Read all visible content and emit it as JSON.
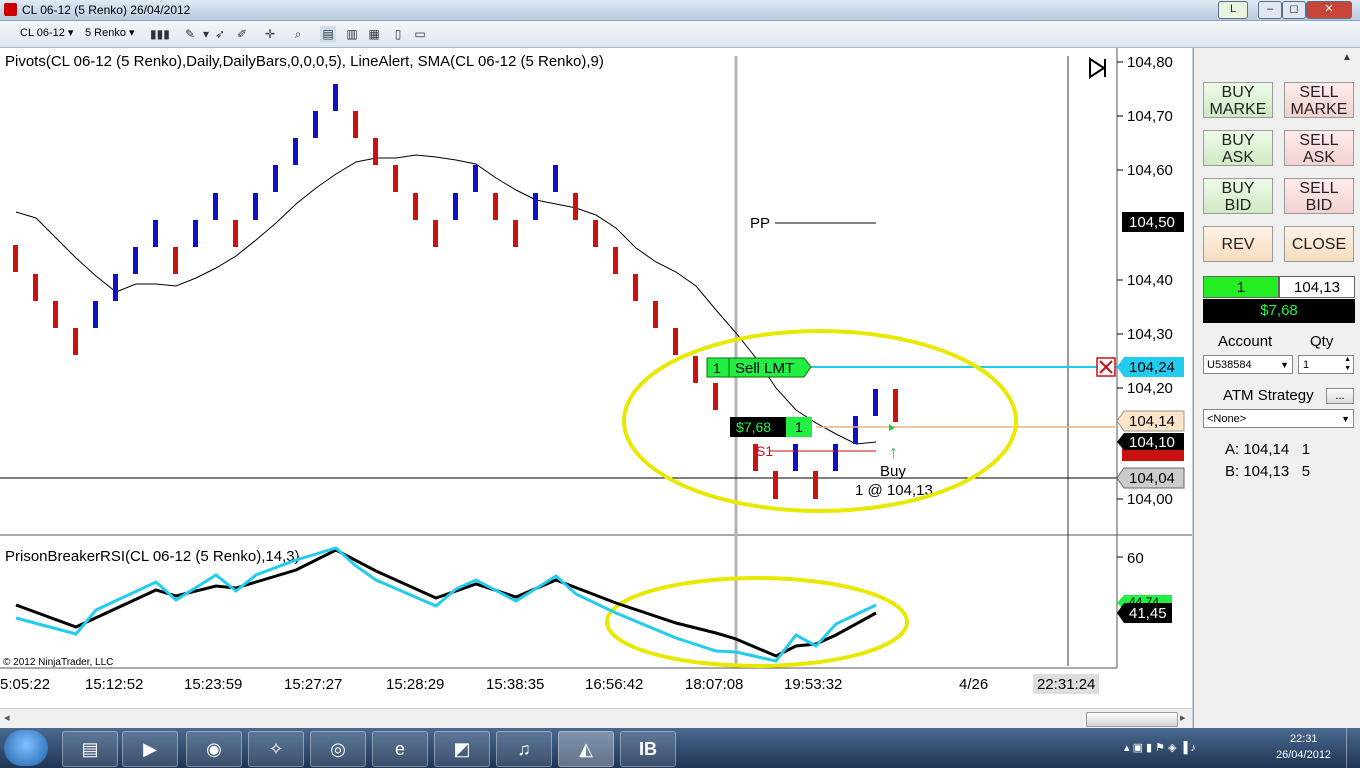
{
  "window": {
    "title": "CL 06-12 (5 Renko)  26/04/2012",
    "l_button": "L"
  },
  "toolbar": {
    "instrument": "CL 06-12",
    "bar_type": "5 Renko"
  },
  "chart": {
    "indicator_label": "Pivots(CL 06-12 (5 Renko),Daily,DailyBars,0,0,0,5), LineAlert, SMA(CL 06-12 (5 Renko),9)",
    "price_ticks": [
      "104,80",
      "104,70",
      "104,60",
      "104,50",
      "104,40",
      "104,30",
      "104,24",
      "104,20",
      "104,14",
      "104,10",
      "104,04",
      "104,00"
    ],
    "pivot_label": "PP",
    "sell_order": {
      "qty": "1",
      "label": "Sell LMT",
      "price": "104,24"
    },
    "position": {
      "pnl": "$7,68",
      "qty": "1"
    },
    "s1_label": "S1",
    "buy_marker": {
      "label": "Buy",
      "detail": "1 @ 104,13"
    },
    "rsi_label": "PrisonBreakerRSI(CL 06-12 (5 Renko),14,3)",
    "rsi_ticks": {
      "level60": "60",
      "value1": "44,74",
      "value2": "41,45"
    },
    "copyright": "© 2012 NinjaTrader, LLC",
    "time_labels": [
      "5:05:22",
      "15:12:52",
      "15:23:59",
      "15:27:27",
      "15:28:29",
      "15:38:35",
      "16:56:42",
      "18:07:08",
      "19:53:32",
      "4/26"
    ],
    "current_time": "22:31:24"
  },
  "panel": {
    "buy_market": "BUY\nMARKE",
    "sell_market": "SELL\nMARKE",
    "buy_ask": "BUY\nASK",
    "sell_ask": "SELL\nASK",
    "buy_bid": "BUY\nBID",
    "sell_bid": "SELL\nBID",
    "rev": "REV",
    "close": "CLOSE",
    "pos_qty": "1",
    "pos_price": "104,13",
    "pos_pnl": "$7,68",
    "account_label": "Account",
    "qty_label": "Qty",
    "account_value": "U538584",
    "qty_value": "1",
    "atm_label": "ATM Strategy",
    "atm_btn": "...",
    "atm_value": "<None>",
    "ask_line": "A: 104,14   1",
    "bid_line": "B: 104,13   5"
  },
  "taskbar": {
    "time": "22:31",
    "date": "26/04/2012",
    "lang": "IB"
  },
  "colors": {
    "up_bar": "#1010c8",
    "down_bar": "#cc1111",
    "sma": "#000000",
    "rsi_fast": "#22ccee",
    "highlight": "#e8e800"
  }
}
